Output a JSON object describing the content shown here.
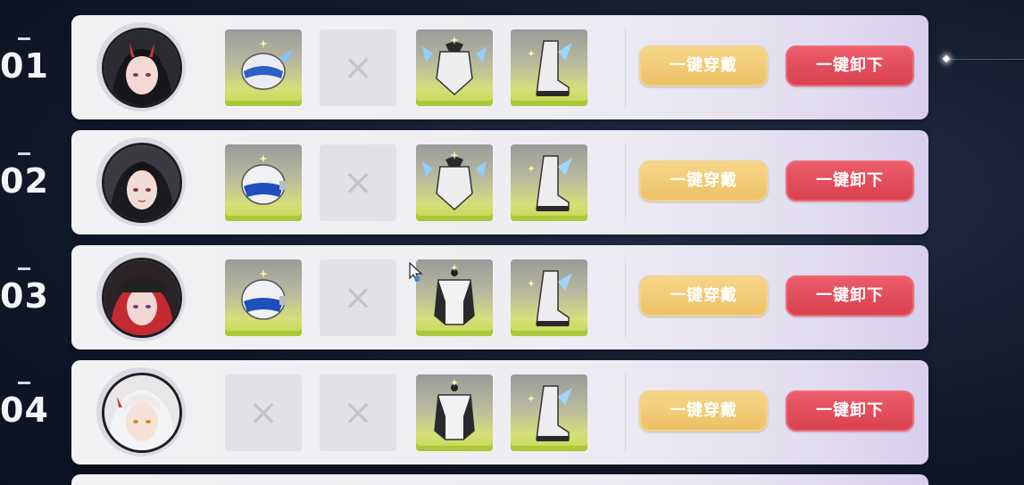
{
  "buttons": {
    "equip_all": "一键穿戴",
    "unequip_all": "一键卸下"
  },
  "empty_slot_mark": "×",
  "rows": [
    {
      "number": "01",
      "slots": [
        "visor-helmet",
        "empty",
        "winged-armor",
        "winged-boots"
      ]
    },
    {
      "number": "02",
      "slots": [
        "blue-helmet",
        "empty",
        "winged-armor",
        "winged-boots"
      ]
    },
    {
      "number": "03",
      "slots": [
        "blue-helmet",
        "empty",
        "plain-armor",
        "winged-boots"
      ]
    },
    {
      "number": "04",
      "slots": [
        "empty",
        "empty",
        "plain-armor",
        "winged-boots"
      ]
    }
  ],
  "colors": {
    "equip_button": "#edc064",
    "unequip_button": "#d8404f",
    "slot_glow": "#c6d94c"
  }
}
